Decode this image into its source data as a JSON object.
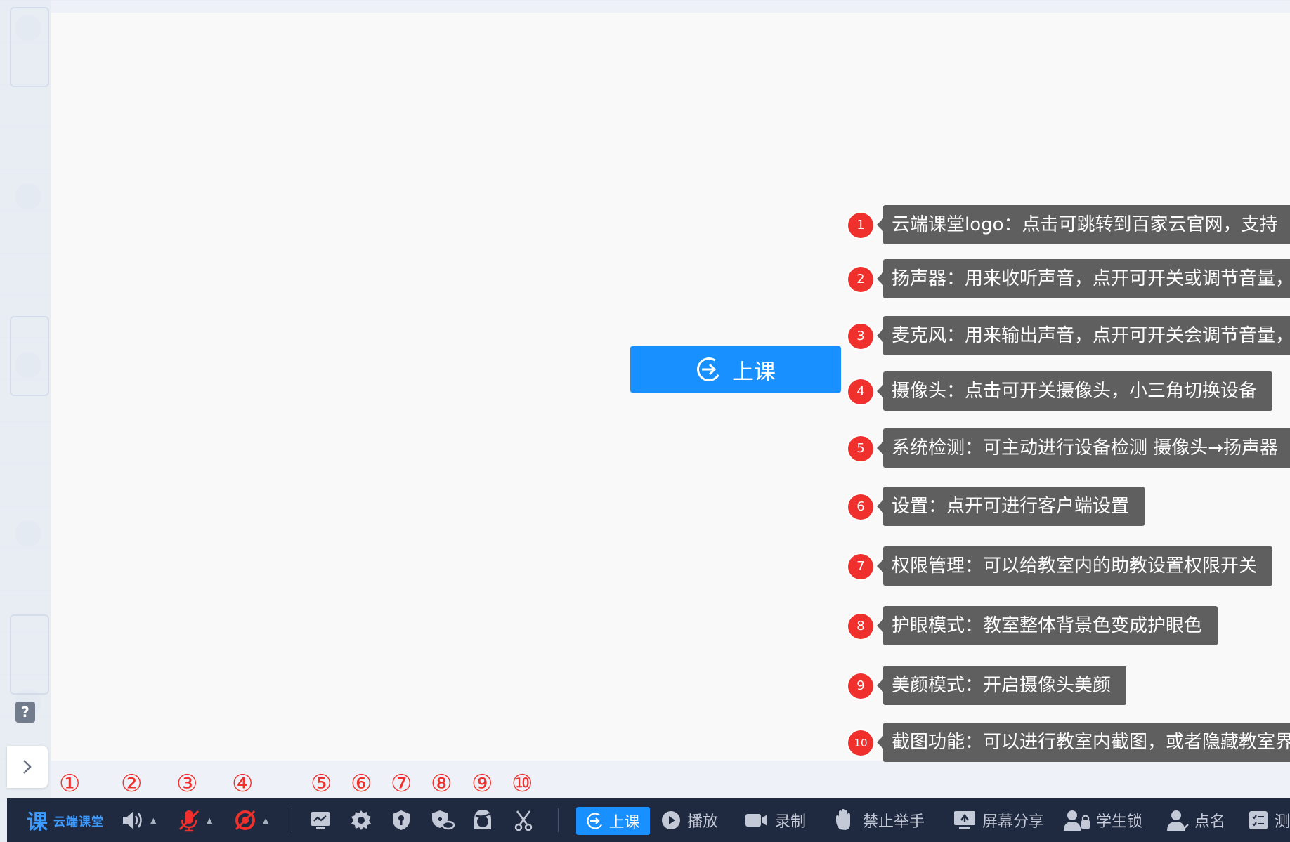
{
  "classroom": {
    "start_class_label": "上课"
  },
  "annotations": [
    {
      "num": "1",
      "text": "云端课堂logo：点击可跳转到百家云官网，支持"
    },
    {
      "num": "2",
      "text": "扬声器：用来收听声音，点开可开关或调节音量，"
    },
    {
      "num": "3",
      "text": "麦克风：用来输出声音，点开可开关会调节音量，"
    },
    {
      "num": "4",
      "text": "摄像头：点击可开关摄像头，小三角切换设备"
    },
    {
      "num": "5",
      "text": "系统检测：可主动进行设备检测 摄像头→扬声器"
    },
    {
      "num": "6",
      "text": "设置：点开可进行客户端设置"
    },
    {
      "num": "7",
      "text": "权限管理：可以给教室内的助教设置权限开关"
    },
    {
      "num": "8",
      "text": "护眼模式：教室整体背景色变成护眼色"
    },
    {
      "num": "9",
      "text": "美颜模式：开启摄像头美颜"
    },
    {
      "num": "10",
      "text": "截图功能：可以进行教室内截图，或者隐藏教室界"
    }
  ],
  "circled_numbers": [
    "①",
    "②",
    "③",
    "④",
    "⑤",
    "⑥",
    "⑦",
    "⑧",
    "⑨",
    "⑩"
  ],
  "toolbar": {
    "logo_text": "云端课堂",
    "start_label": "上课",
    "play_label": "播放",
    "record_label": "录制",
    "no_hand_label": "禁止举手",
    "screen_share_label": "屏幕分享",
    "student_lock_label": "学生锁",
    "rollcall_label": "点名",
    "test_label": "测"
  },
  "colors": {
    "primary": "#1890ff",
    "annotation_red": "#f0302c",
    "toolbar_bg": "#1f2940",
    "tooltip_bg": "#5f5f5f"
  }
}
